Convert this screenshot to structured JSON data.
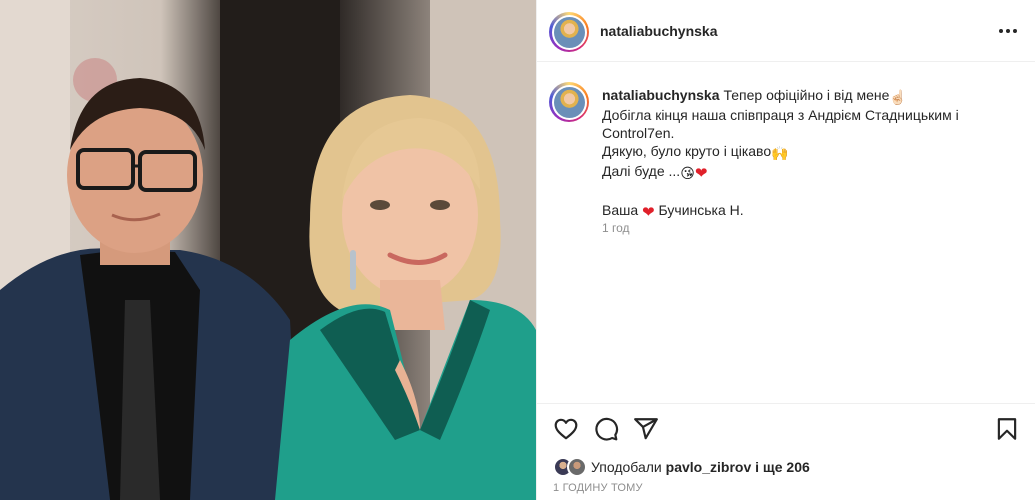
{
  "post": {
    "username": "nataliabuchynska",
    "more_label": "•••"
  },
  "caption": {
    "username": "nataliabuchynska",
    "line1": "Тепер офіційно і від мене",
    "line2": "Добігла кінця наша співпраця з Андрієм Стадницьким і Control7en.",
    "line3": "Дякую, було круто і цікаво",
    "line4": "Далі буде ...",
    "sign_prefix": "Ваша",
    "sign_suffix": "Бучинська Н.",
    "emoji_point": "☝🏻",
    "emoji_hands": "🙌",
    "emoji_kiss": "😘",
    "emoji_heart": "❤",
    "posted_ago": "1 год"
  },
  "likes": {
    "prefix": "Уподобали",
    "user": "pavlo_zibrov",
    "suffix": "і ще 206"
  },
  "timestamp": "1 ГОДИНУ ТОМУ",
  "icons": {
    "like": "heart-outline-icon",
    "comment": "comment-bubble-icon",
    "share": "paper-plane-icon",
    "save": "bookmark-icon",
    "more": "more-horizontal-icon"
  },
  "colors": {
    "text": "#262626",
    "muted": "#8e8e8e",
    "divider": "#efefef",
    "heart": "#e0202a",
    "dress": "#1e9e8a"
  }
}
